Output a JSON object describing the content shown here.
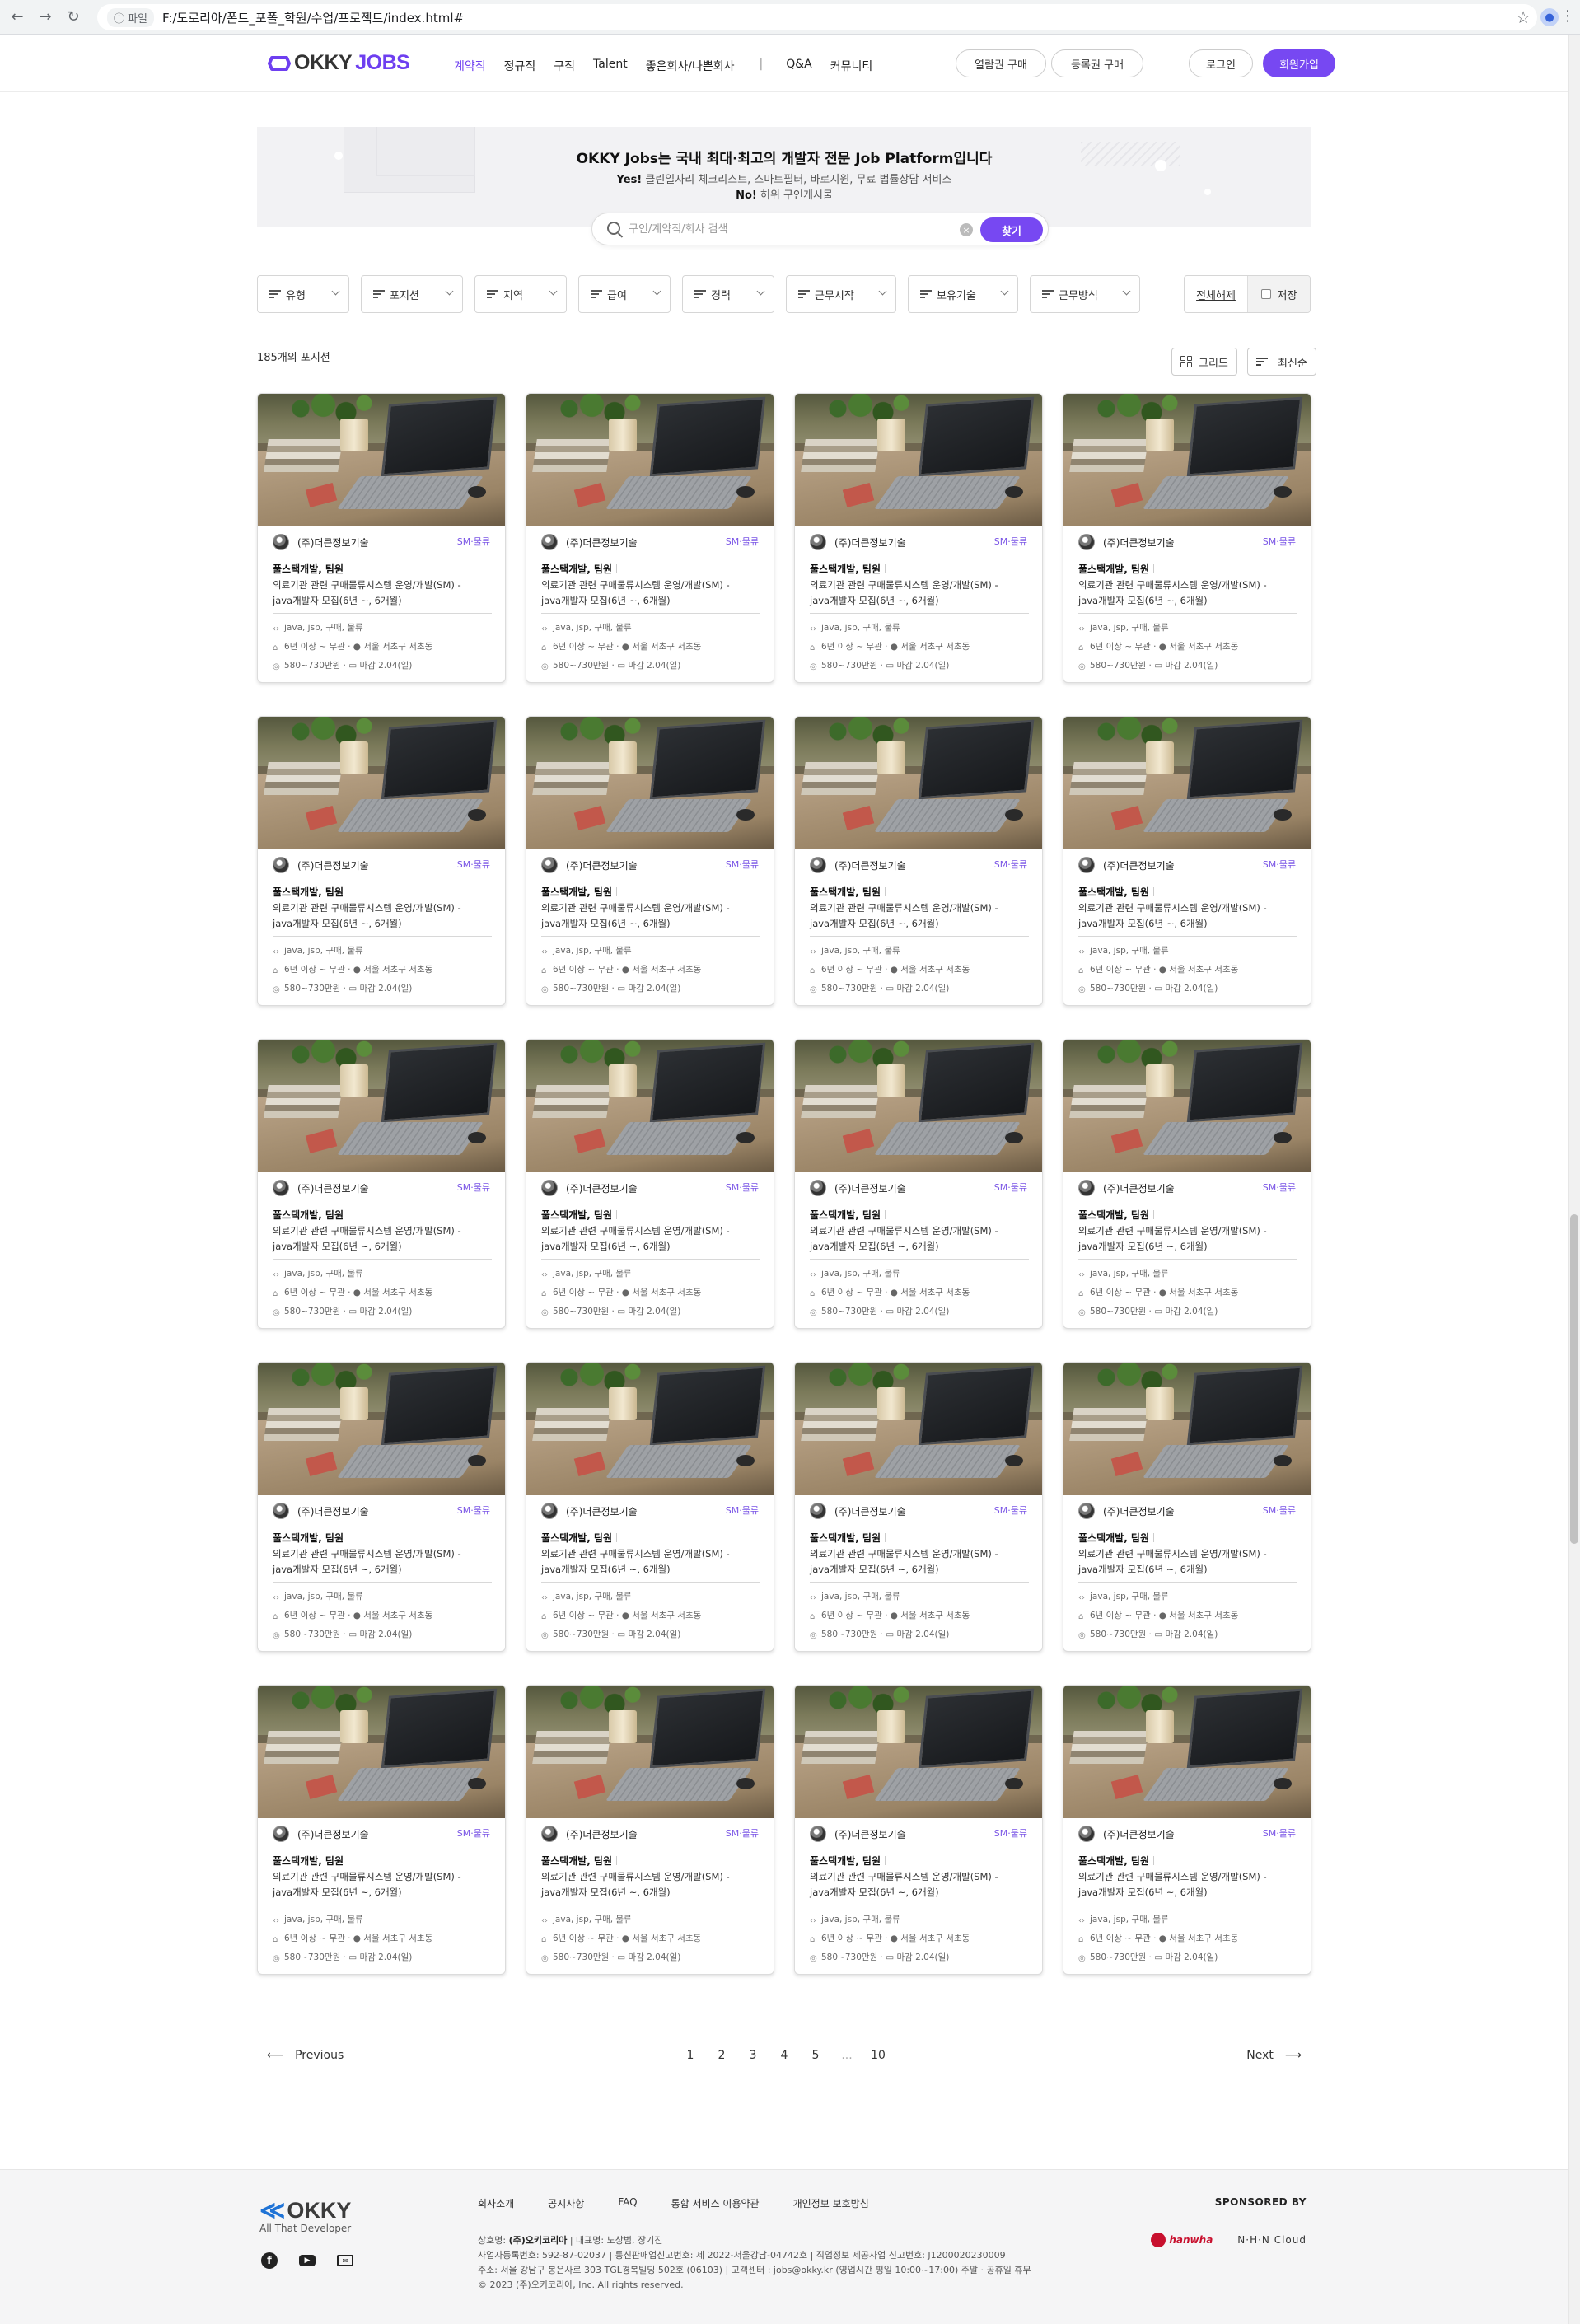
{
  "browser": {
    "scheme_label": "파일",
    "url": "F:/도로리아/폰트_포폴_학원/수업/프로젝트/index.html#"
  },
  "header": {
    "logo_okky": "OKKY",
    "logo_jobs": "JOBS",
    "nav": [
      "계약직",
      "정규직",
      "구직",
      "Talent",
      "좋은회사/나쁜회사",
      "Q&A",
      "커뮤니티"
    ],
    "nav_separator": "|",
    "btn_view_ticket": "열람권 구매",
    "btn_reg_ticket": "등록권 구매",
    "btn_login": "로그인",
    "btn_signup": "회원가입",
    "accent": "#7748f2"
  },
  "hero": {
    "title": "OKKY Jobs는 국내 최대·최고의 개발자 전문 Job Platform입니다",
    "line1_strong": "Yes!",
    "line1": " 클린일자리 체크리스트, 스마트필터, 바로지원, 무료 법률상담 서비스",
    "line2_strong": "No!",
    "line2": " 허위 구인게시물",
    "search_placeholder": "구인/계약직/회사 검색",
    "search_button": "찾기"
  },
  "filters": {
    "items": [
      "유형",
      "포지션",
      "지역",
      "급여",
      "경력",
      "근무시작",
      "보유기술",
      "근무방식"
    ],
    "reset": "전체해제",
    "save": "저장"
  },
  "listing": {
    "count": "185개의 포지션",
    "view_grid": "그리드",
    "sort": "최신순"
  },
  "job": {
    "company": "(주)더큰정보기술",
    "tag": "SM·물류",
    "title": "풀스택개발, 팀원",
    "desc1": "의료기관 관련 구매물류시스템 운영/개발(SM) -",
    "desc2": "java개발자 모집(6년 ~, 6개월)",
    "skills": "java, jsp, 구매, 물류",
    "career_location": "6년 이상 ~ 무관 · ● 서울 서초구 서초동",
    "salary_deadline": "580~730만원 · ▭ 마감 2.04(일)"
  },
  "pagination": {
    "prev": "Previous",
    "next": "Next",
    "pages": [
      "1",
      "2",
      "3",
      "4",
      "5",
      "...",
      "10"
    ]
  },
  "footer": {
    "logo": "OKKY",
    "tagline": "All That Developer",
    "links": [
      "회사소개",
      "공지사항",
      "FAQ",
      "통합 서비스 이용약관",
      "개인정보 보호방침"
    ],
    "info_line1_label": "상호명: ",
    "info_line1_company": "(주)오키코리아",
    "info_line1_rest": " | 대표명: 노상범, 장기진",
    "info_line2": "사업자등록번호: 592-87-02037 | 통신판매업신고번호: 제 2022-서울강남-04742호 | 직업정보 제공사업 신고번호: J1200020230009",
    "info_line3": "주소: 서울 강남구 봉은사로 303 TGL경복빌딩 502호 (06103) | 고객센터 : jobs@okky.kr (영업시간 평일 10:00~17:00) 주말 · 공휴일 휴무",
    "info_line4": "© 2023 (주)오키코리아, Inc. All rights reserved.",
    "sponsored": "SPONSORED BY",
    "sponsor1": "hanwha",
    "sponsor2": "N·H·N Cloud"
  }
}
